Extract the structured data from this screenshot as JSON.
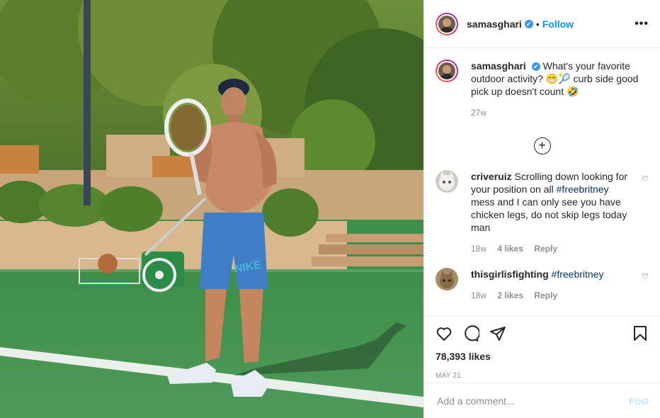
{
  "header": {
    "username": "samasghari",
    "verified_glyph": "✔",
    "separator": "•",
    "follow_label": "Follow",
    "more_glyph": "•••"
  },
  "caption": {
    "username": "samasghari",
    "text_part1": "What's your favorite outdoor activity? ",
    "emoji1": "😁🎾",
    "text_part2": " curb side good pick up doesn't count ",
    "emoji2": "🤣",
    "age": "27w"
  },
  "add_more_glyph": "+",
  "comments": [
    {
      "username": "criveruiz",
      "text_part1": "Scrolling down looking for your position on all ",
      "hashtag": "#freebritney",
      "text_part2": " mess and I can only see you have chicken legs, do not skip legs today man",
      "age": "18w",
      "likes": "4 likes",
      "reply": "Reply"
    },
    {
      "username": "thisgirlisfighting",
      "text_part1": "",
      "hashtag": "#freebritney",
      "text_part2": "",
      "age": "18w",
      "likes": "2 likes",
      "reply": "Reply"
    }
  ],
  "icons": {
    "like": "heart-icon",
    "comment": "comment-icon",
    "share": "share-icon",
    "save": "bookmark-icon"
  },
  "likes_count": "78,393 likes",
  "post_date": "MAY 21",
  "comment_box": {
    "placeholder": "Add a comment...",
    "post_label": "Post"
  },
  "colors": {
    "link": "#0095f6",
    "hashtag": "#00376b",
    "post_disabled": "#b2dffc",
    "court": "#3f8f4a"
  }
}
